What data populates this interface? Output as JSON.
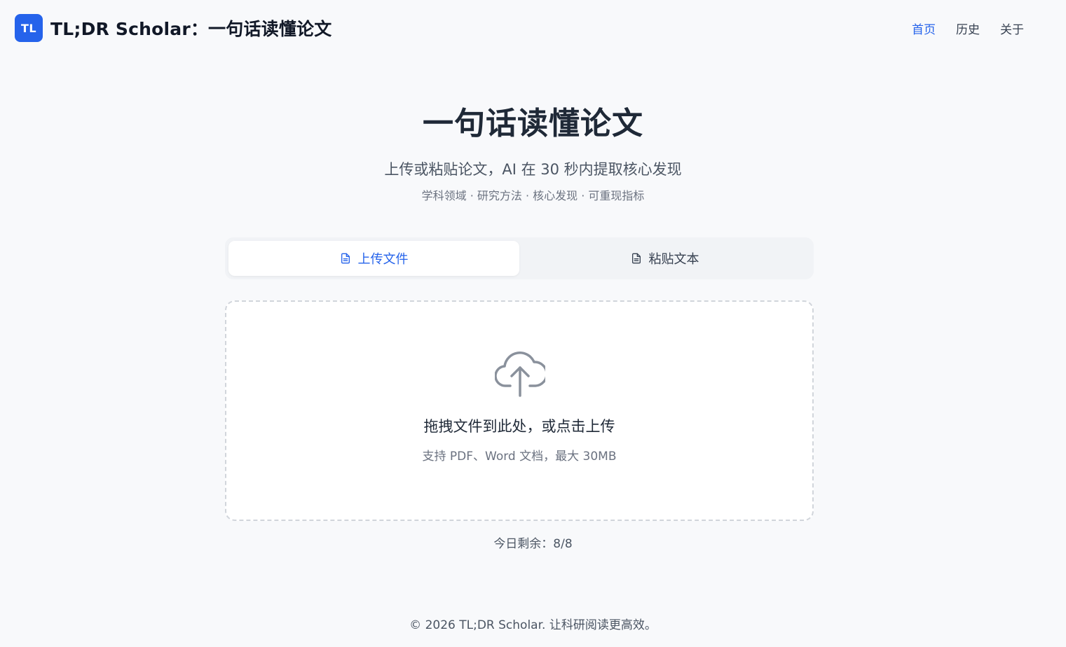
{
  "header": {
    "logo_text": "TL",
    "title": "TL;DR Scholar：一句话读懂论文",
    "nav": [
      {
        "label": "首页",
        "active": true
      },
      {
        "label": "历史",
        "active": false
      },
      {
        "label": "关于",
        "active": false
      }
    ]
  },
  "hero": {
    "title": "一句话读懂论文",
    "subtitle": "上传或粘贴论文，AI 在 30 秒内提取核心发现",
    "tags": "学科领域 · 研究方法 · 核心发现 · 可重现指标"
  },
  "tabs": [
    {
      "label": "上传文件",
      "icon": "document-icon",
      "active": true
    },
    {
      "label": "粘贴文本",
      "icon": "document-icon",
      "active": false
    }
  ],
  "dropzone": {
    "icon": "cloud-upload-icon",
    "title": "拖拽文件到此处，或点击上传",
    "hint": "支持 PDF、Word 文档，最大 30MB"
  },
  "remaining": "今日剩余：8/8",
  "footer": "© 2026 TL;DR Scholar. 让科研阅读更高效。",
  "colors": {
    "accent": "#2563eb",
    "background": "#f8f9fb",
    "text": "#1f2937",
    "muted": "#6b7280"
  }
}
